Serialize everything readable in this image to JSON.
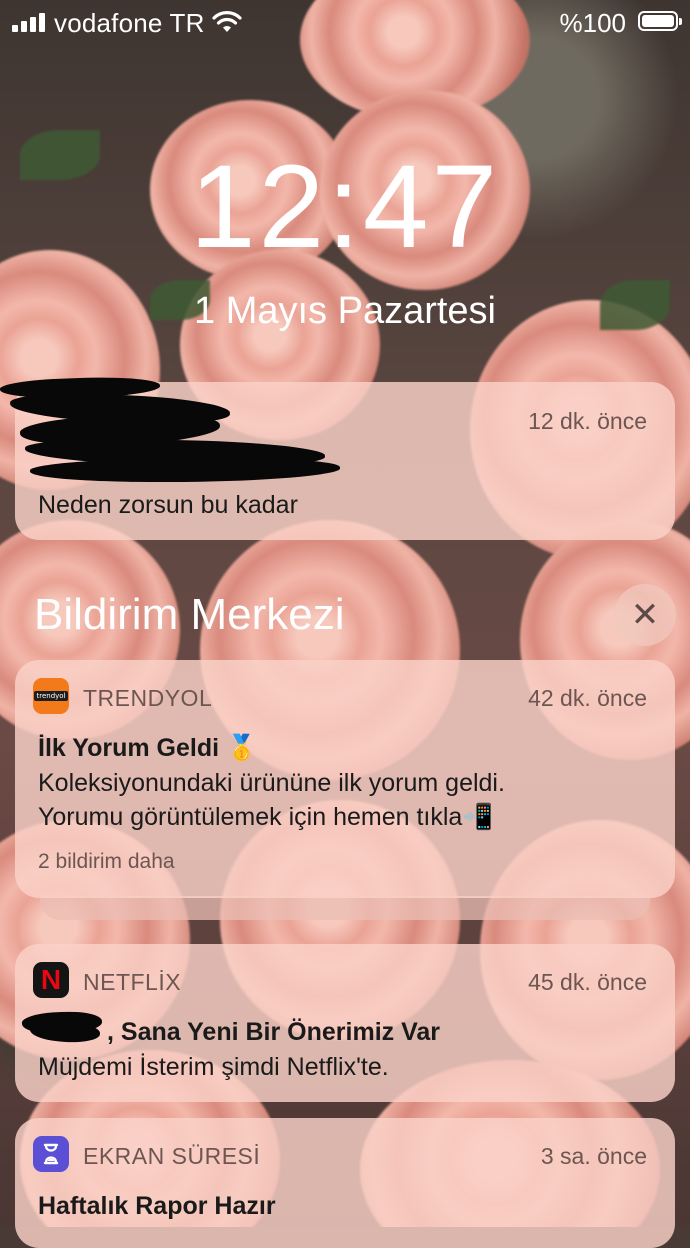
{
  "status_bar": {
    "carrier": "vodafone TR",
    "battery": "%100",
    "signal_icon": "signal-bars-icon",
    "wifi_icon": "wifi-icon",
    "battery_icon": "battery-icon"
  },
  "lock_screen": {
    "time": "12:47",
    "date": "1 Mayıs Pazartesi"
  },
  "top_notification": {
    "time": "12 dk. önce",
    "body": "Neden zorsun bu kadar"
  },
  "notification_center": {
    "title": "Bildirim Merkezi",
    "close_icon": "close-icon",
    "close_label": "✕"
  },
  "notifications": [
    {
      "app": "TRENDYOL",
      "icon": "trendyol-icon",
      "icon_label": "trendyol",
      "icon_color": "#f27a1a",
      "time": "42 dk. önce",
      "title": "İlk Yorum Geldi 🥇",
      "body_line1": "Koleksiyonundaki ürününe ilk yorum geldi.",
      "body_line2": "Yorumu görüntülemek için hemen tıkla📲",
      "more": "2 bildirim daha"
    },
    {
      "app": "NETFLİX",
      "icon": "netflix-icon",
      "icon_label": "N",
      "icon_color": "#e50914",
      "time": "45 dk. önce",
      "title": ", Sana Yeni Bir Önerimiz Var",
      "body": "Müjdemi İsterim şimdi Netflix'te."
    },
    {
      "app": "EKRAN SÜRESİ",
      "icon": "hourglass-icon",
      "icon_color": "#5b4fd6",
      "time": "3 sa. önce",
      "title": "Haftalık Rapor Hazır"
    }
  ]
}
